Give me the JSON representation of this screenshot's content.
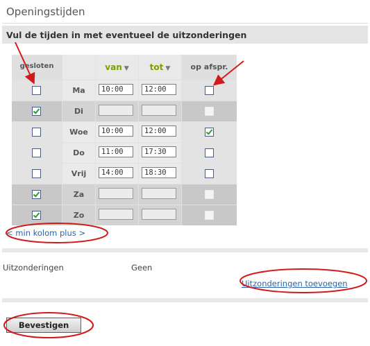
{
  "title": "Openingstijden",
  "section": "Vul de tijden in met eventueel de uitzonderingen",
  "columns": {
    "closed": "gesloten",
    "from": "van",
    "to": "tot",
    "appointment": "op afspr."
  },
  "days": [
    {
      "label": "Ma",
      "closed": false,
      "from": "10:00",
      "to": "12:00",
      "appointment": false
    },
    {
      "label": "Di",
      "closed": true,
      "from": "",
      "to": "",
      "appointment": false
    },
    {
      "label": "Woe",
      "closed": false,
      "from": "10:00",
      "to": "12:00",
      "appointment": true
    },
    {
      "label": "Do",
      "closed": false,
      "from": "11:00",
      "to": "17:30",
      "appointment": false
    },
    {
      "label": "Vrij",
      "closed": false,
      "from": "14:00",
      "to": "18:30",
      "appointment": false
    },
    {
      "label": "Za",
      "closed": true,
      "from": "",
      "to": "",
      "appointment": false
    },
    {
      "label": "Zo",
      "closed": true,
      "from": "",
      "to": "",
      "appointment": false
    }
  ],
  "pager": "< min kolom plus >",
  "exceptions": {
    "label": "Uitzonderingen",
    "value": "Geen",
    "add_link": "Uitzonderingen toevoegen"
  },
  "confirm_label": "Bevestigen",
  "annotation_color": "#d11a1a"
}
